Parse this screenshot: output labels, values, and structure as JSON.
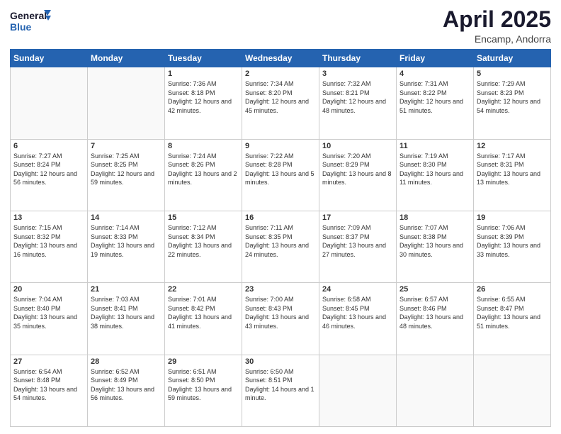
{
  "header": {
    "logo_line1": "General",
    "logo_line2": "Blue",
    "month": "April 2025",
    "location": "Encamp, Andorra"
  },
  "days_of_week": [
    "Sunday",
    "Monday",
    "Tuesday",
    "Wednesday",
    "Thursday",
    "Friday",
    "Saturday"
  ],
  "weeks": [
    [
      {
        "num": "",
        "info": ""
      },
      {
        "num": "",
        "info": ""
      },
      {
        "num": "1",
        "info": "Sunrise: 7:36 AM\nSunset: 8:18 PM\nDaylight: 12 hours and 42 minutes."
      },
      {
        "num": "2",
        "info": "Sunrise: 7:34 AM\nSunset: 8:20 PM\nDaylight: 12 hours and 45 minutes."
      },
      {
        "num": "3",
        "info": "Sunrise: 7:32 AM\nSunset: 8:21 PM\nDaylight: 12 hours and 48 minutes."
      },
      {
        "num": "4",
        "info": "Sunrise: 7:31 AM\nSunset: 8:22 PM\nDaylight: 12 hours and 51 minutes."
      },
      {
        "num": "5",
        "info": "Sunrise: 7:29 AM\nSunset: 8:23 PM\nDaylight: 12 hours and 54 minutes."
      }
    ],
    [
      {
        "num": "6",
        "info": "Sunrise: 7:27 AM\nSunset: 8:24 PM\nDaylight: 12 hours and 56 minutes."
      },
      {
        "num": "7",
        "info": "Sunrise: 7:25 AM\nSunset: 8:25 PM\nDaylight: 12 hours and 59 minutes."
      },
      {
        "num": "8",
        "info": "Sunrise: 7:24 AM\nSunset: 8:26 PM\nDaylight: 13 hours and 2 minutes."
      },
      {
        "num": "9",
        "info": "Sunrise: 7:22 AM\nSunset: 8:28 PM\nDaylight: 13 hours and 5 minutes."
      },
      {
        "num": "10",
        "info": "Sunrise: 7:20 AM\nSunset: 8:29 PM\nDaylight: 13 hours and 8 minutes."
      },
      {
        "num": "11",
        "info": "Sunrise: 7:19 AM\nSunset: 8:30 PM\nDaylight: 13 hours and 11 minutes."
      },
      {
        "num": "12",
        "info": "Sunrise: 7:17 AM\nSunset: 8:31 PM\nDaylight: 13 hours and 13 minutes."
      }
    ],
    [
      {
        "num": "13",
        "info": "Sunrise: 7:15 AM\nSunset: 8:32 PM\nDaylight: 13 hours and 16 minutes."
      },
      {
        "num": "14",
        "info": "Sunrise: 7:14 AM\nSunset: 8:33 PM\nDaylight: 13 hours and 19 minutes."
      },
      {
        "num": "15",
        "info": "Sunrise: 7:12 AM\nSunset: 8:34 PM\nDaylight: 13 hours and 22 minutes."
      },
      {
        "num": "16",
        "info": "Sunrise: 7:11 AM\nSunset: 8:35 PM\nDaylight: 13 hours and 24 minutes."
      },
      {
        "num": "17",
        "info": "Sunrise: 7:09 AM\nSunset: 8:37 PM\nDaylight: 13 hours and 27 minutes."
      },
      {
        "num": "18",
        "info": "Sunrise: 7:07 AM\nSunset: 8:38 PM\nDaylight: 13 hours and 30 minutes."
      },
      {
        "num": "19",
        "info": "Sunrise: 7:06 AM\nSunset: 8:39 PM\nDaylight: 13 hours and 33 minutes."
      }
    ],
    [
      {
        "num": "20",
        "info": "Sunrise: 7:04 AM\nSunset: 8:40 PM\nDaylight: 13 hours and 35 minutes."
      },
      {
        "num": "21",
        "info": "Sunrise: 7:03 AM\nSunset: 8:41 PM\nDaylight: 13 hours and 38 minutes."
      },
      {
        "num": "22",
        "info": "Sunrise: 7:01 AM\nSunset: 8:42 PM\nDaylight: 13 hours and 41 minutes."
      },
      {
        "num": "23",
        "info": "Sunrise: 7:00 AM\nSunset: 8:43 PM\nDaylight: 13 hours and 43 minutes."
      },
      {
        "num": "24",
        "info": "Sunrise: 6:58 AM\nSunset: 8:45 PM\nDaylight: 13 hours and 46 minutes."
      },
      {
        "num": "25",
        "info": "Sunrise: 6:57 AM\nSunset: 8:46 PM\nDaylight: 13 hours and 48 minutes."
      },
      {
        "num": "26",
        "info": "Sunrise: 6:55 AM\nSunset: 8:47 PM\nDaylight: 13 hours and 51 minutes."
      }
    ],
    [
      {
        "num": "27",
        "info": "Sunrise: 6:54 AM\nSunset: 8:48 PM\nDaylight: 13 hours and 54 minutes."
      },
      {
        "num": "28",
        "info": "Sunrise: 6:52 AM\nSunset: 8:49 PM\nDaylight: 13 hours and 56 minutes."
      },
      {
        "num": "29",
        "info": "Sunrise: 6:51 AM\nSunset: 8:50 PM\nDaylight: 13 hours and 59 minutes."
      },
      {
        "num": "30",
        "info": "Sunrise: 6:50 AM\nSunset: 8:51 PM\nDaylight: 14 hours and 1 minute."
      },
      {
        "num": "",
        "info": ""
      },
      {
        "num": "",
        "info": ""
      },
      {
        "num": "",
        "info": ""
      }
    ]
  ]
}
